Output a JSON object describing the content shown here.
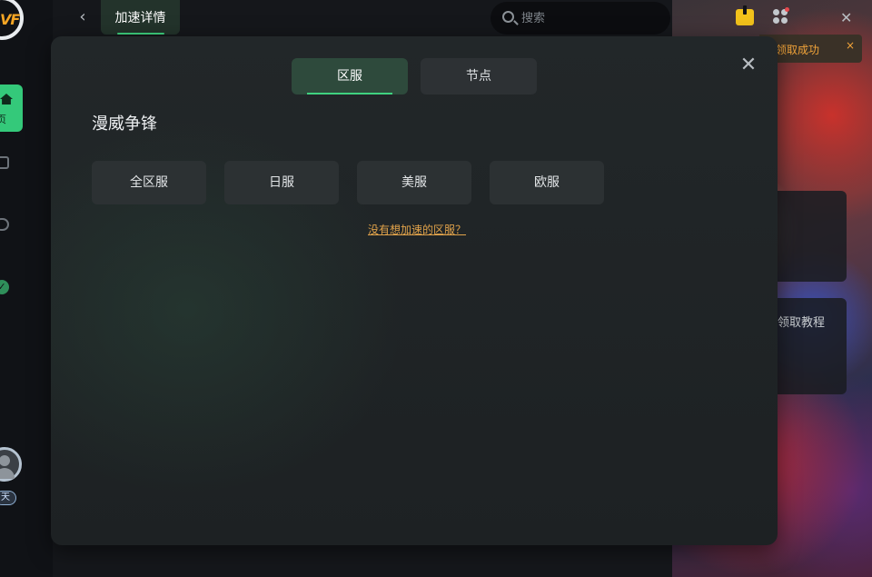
{
  "header": {
    "tab_title": "加速详情",
    "search_placeholder": "搜索"
  },
  "sidebar": {
    "home_label": "页",
    "vip_badge": "天"
  },
  "notification": {
    "toast_text": "领取成功",
    "toast_close": "×"
  },
  "background_cards": {
    "card2_text": "领取教程"
  },
  "modal": {
    "segments": [
      "区服",
      "节点"
    ],
    "active_segment": "区服",
    "game_title": "漫威争锋",
    "regions": [
      "全区服",
      "日服",
      "美服",
      "欧服"
    ],
    "help_link": "没有想加速的区服？",
    "close": "✕"
  },
  "colors": {
    "accent_green": "#3fd27f",
    "link_orange": "#e0a24a",
    "toast_orange": "#f2a43a"
  }
}
